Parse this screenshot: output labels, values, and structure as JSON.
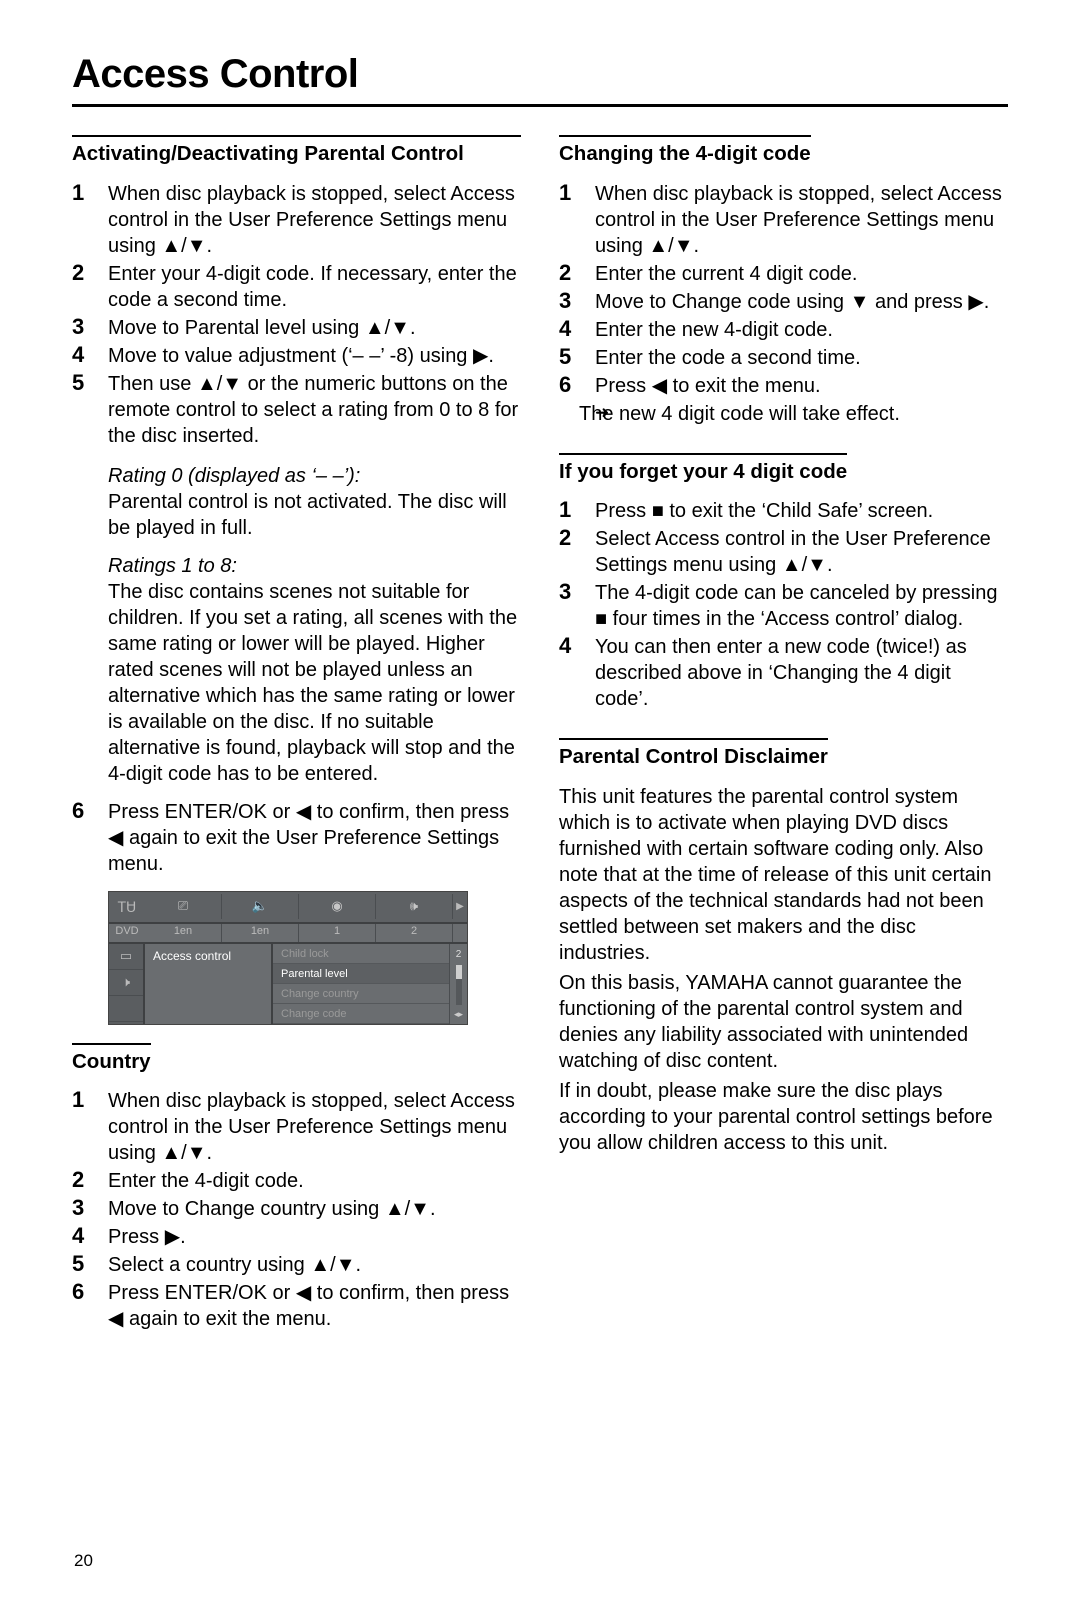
{
  "title": "Access Control",
  "page_number": "20",
  "icons": {
    "up": "▲",
    "down": "▼",
    "left": "◀",
    "right": "▶",
    "stop": "■",
    "updown": "▲/▼"
  },
  "left": {
    "sec1": {
      "heading": "Activating/Deactivating Parental Control",
      "step1_a": "When disc playback is stopped, select Access control in the User Preference Settings menu using ",
      "step1_b": ".",
      "step2": "Enter your 4-digit code. If necessary, enter the code a second time.",
      "step3_a": "Move to Parental level using ",
      "step3_b": ".",
      "step4_a": "Move to value adjustment (‘– –’ -8) using ",
      "step4_b": ".",
      "step5_a": "Then use ",
      "step5_b": " or the numeric buttons on the remote control to select a rating from 0 to 8 for the disc inserted.",
      "rating0_hdr": "Rating 0 (displayed as ‘– –’):",
      "rating0_txt": "Parental control is not activated. The disc will be played in full.",
      "ratings18_hdr": "Ratings 1 to 8:",
      "ratings18_txt": "The disc contains scenes not suitable for children. If you set a rating, all scenes with the same rating or lower will be played. Higher rated scenes will not be played unless an alternative which has the same rating or lower is available on the disc. If no suitable alternative is found, playback will stop and the 4-digit code has to be entered.",
      "step6_a": "Press ENTER/OK or ",
      "step6_b": " to confirm, then press ",
      "step6_c": " again to exit the User Preference Settings menu."
    },
    "figure": {
      "dvd_label": "DVD",
      "tab_lang1": "1en",
      "tab_lang2": "1en",
      "tab_1": "1",
      "tab_2": "2",
      "left_item": "Access control",
      "r1": "Child lock",
      "r2": "Parental level",
      "r3": "Change country",
      "r4": "Change code",
      "scroll_counter": "2"
    },
    "sec2": {
      "heading": "Country",
      "step1_a": "When disc playback is stopped, select Access control in the User Preference Settings menu using ",
      "step1_b": ".",
      "step2": "Enter the 4-digit code.",
      "step3_a": "Move to Change country using ",
      "step3_b": ".",
      "step4_a": "Press ",
      "step4_b": ".",
      "step5_a": "Select a country using ",
      "step5_b": ".",
      "step6_a": "Press ENTER/OK or ",
      "step6_b": " to confirm, then press ",
      "step6_c": " again to exit the menu."
    }
  },
  "right": {
    "sec1": {
      "heading": "Changing the 4-digit code",
      "step1_a": "When disc playback is stopped, select Access control in the User Preference Settings menu using ",
      "step1_b": ".",
      "step2": "Enter the current 4 digit code.",
      "step3_a": "Move to Change code using ",
      "step3_b": " and press ",
      "step3_c": ".",
      "step4": "Enter the new 4-digit code.",
      "step5": "Enter the code a second time.",
      "step6_a": "Press ",
      "step6_b": " to exit the menu.",
      "note": "The new 4 digit code will take effect."
    },
    "sec2": {
      "heading": "If you forget your 4 digit code",
      "step1_a": "Press ",
      "step1_b": " to exit the ‘Child Safe’ screen.",
      "step2_a": "Select Access control in the User Preference Settings menu using ",
      "step2_b": ".",
      "step3_a": "The 4-digit code can be canceled by pressing ",
      "step3_b": " four times in the ‘Access control’ dialog.",
      "step4": "You can then enter a new code (twice!) as described above in ‘Changing the 4 digit code’."
    },
    "sec3": {
      "heading": "Parental Control Disclaimer",
      "p1": "This unit features the parental control system which is to activate when playing DVD discs furnished with certain software coding only. Also note that at the time of release of this unit certain aspects of the technical standards had not been settled between set makers and the disc industries.",
      "p2": "On this basis, YAMAHA cannot guarantee the functioning of the parental control system and denies any liability associated with unintended watching of disc content.",
      "p3": "If in doubt, please make sure the disc plays according to your parental control settings before you allow children access to this unit."
    }
  }
}
